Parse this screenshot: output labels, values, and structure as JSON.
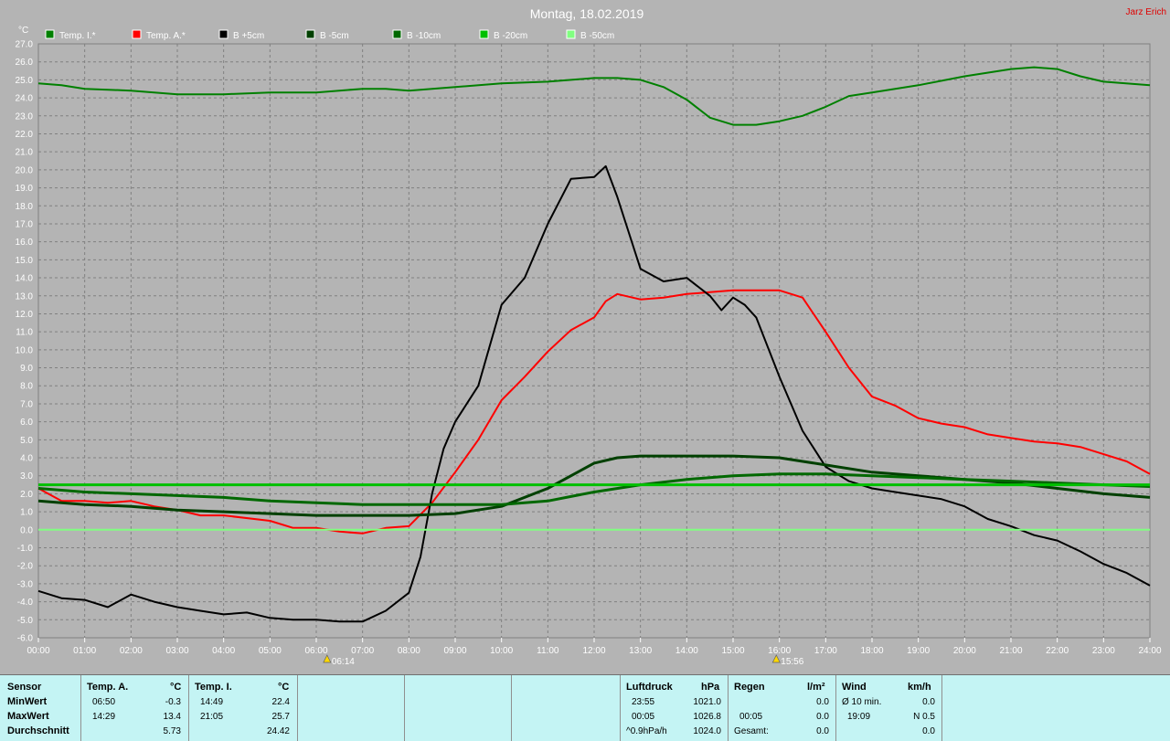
{
  "title": "Montag, 18.02.2019",
  "author": "Jarz Erich",
  "chart_data": {
    "type": "line",
    "ylabel": "°C",
    "ylim": [
      -6,
      27
    ],
    "y_ticks": [
      "27.0",
      "26.0",
      "25.0",
      "24.0",
      "23.0",
      "22.0",
      "21.0",
      "20.0",
      "19.0",
      "18.0",
      "17.0",
      "16.0",
      "15.0",
      "14.0",
      "13.0",
      "12.0",
      "11.0",
      "10.0",
      "9.0",
      "8.0",
      "7.0",
      "6.0",
      "5.0",
      "4.0",
      "3.0",
      "2.0",
      "1.0",
      "0.0",
      "-1.0",
      "-2.0",
      "-3.0",
      "-4.0",
      "-5.0",
      "-6.0"
    ],
    "x_ticks": [
      "00:00",
      "01:00",
      "02:00",
      "03:00",
      "04:00",
      "05:00",
      "06:00",
      "07:00",
      "08:00",
      "09:00",
      "10:00",
      "11:00",
      "12:00",
      "13:00",
      "14:00",
      "15:00",
      "16:00",
      "17:00",
      "18:00",
      "19:00",
      "20:00",
      "21:00",
      "22:00",
      "23:00",
      "24:00"
    ],
    "xlim": [
      0,
      24
    ],
    "grid": true,
    "legend_position": "top",
    "annotations": {
      "sunrise": "06:14",
      "sunset": "15:56"
    },
    "series": [
      {
        "name": "Temp. I.*",
        "color": "#008000",
        "width": 2,
        "x": [
          0,
          0.5,
          1,
          2,
          3,
          4,
          5,
          6,
          7,
          7.5,
          8,
          9,
          10,
          11,
          12,
          12.5,
          13,
          13.5,
          14,
          14.5,
          15,
          15.5,
          16,
          16.5,
          17,
          17.5,
          18,
          19,
          20,
          21,
          21.5,
          22,
          22.5,
          23,
          24
        ],
        "y": [
          24.8,
          24.7,
          24.5,
          24.4,
          24.2,
          24.2,
          24.3,
          24.3,
          24.5,
          24.5,
          24.4,
          24.6,
          24.8,
          24.9,
          25.1,
          25.1,
          25.0,
          24.6,
          23.9,
          22.9,
          22.5,
          22.5,
          22.7,
          23.0,
          23.5,
          24.1,
          24.3,
          24.7,
          25.2,
          25.6,
          25.7,
          25.6,
          25.2,
          24.9,
          24.7
        ]
      },
      {
        "name": "Temp. A.*",
        "color": "#ff0000",
        "width": 2,
        "x": [
          0,
          0.5,
          1,
          1.5,
          2,
          2.5,
          3,
          3.5,
          4,
          5,
          5.5,
          6,
          6.5,
          7,
          7.5,
          8,
          8.5,
          9,
          9.5,
          10,
          10.5,
          11,
          11.5,
          12,
          12.25,
          12.5,
          13,
          13.5,
          14,
          14.5,
          15,
          15.5,
          16,
          16.5,
          17,
          17.5,
          18,
          18.5,
          19,
          19.5,
          20,
          20.5,
          21,
          21.5,
          22,
          22.5,
          23,
          23.5,
          24
        ],
        "y": [
          2.3,
          1.6,
          1.6,
          1.5,
          1.6,
          1.3,
          1.1,
          0.8,
          0.8,
          0.5,
          0.1,
          0.1,
          -0.1,
          -0.2,
          0.1,
          0.2,
          1.5,
          3.2,
          5.0,
          7.2,
          8.5,
          9.9,
          11.1,
          11.8,
          12.7,
          13.1,
          12.8,
          12.9,
          13.1,
          13.2,
          13.3,
          13.3,
          13.3,
          12.9,
          11.0,
          9.0,
          7.4,
          6.9,
          6.2,
          5.9,
          5.7,
          5.3,
          5.1,
          4.9,
          4.8,
          4.6,
          4.2,
          3.8,
          3.1
        ]
      },
      {
        "name": "B +5cm",
        "color": "#000000",
        "width": 2,
        "x": [
          0,
          0.5,
          1,
          1.5,
          2,
          2.5,
          3,
          3.5,
          4,
          4.5,
          5,
          5.5,
          6,
          6.5,
          7,
          7.5,
          8,
          8.25,
          8.5,
          8.75,
          9,
          9.5,
          10,
          10.5,
          11,
          11.5,
          12,
          12.25,
          12.5,
          13,
          13.5,
          14,
          14.5,
          14.75,
          15,
          15.25,
          15.5,
          16,
          16.5,
          17,
          17.5,
          18,
          18.5,
          19,
          19.5,
          20,
          20.5,
          21,
          21.5,
          22,
          22.5,
          23,
          23.5,
          24
        ],
        "y": [
          -3.4,
          -3.8,
          -3.9,
          -4.3,
          -3.6,
          -4.0,
          -4.3,
          -4.5,
          -4.7,
          -4.6,
          -4.9,
          -5.0,
          -5.0,
          -5.1,
          -5.1,
          -4.5,
          -3.5,
          -1.5,
          2.0,
          4.5,
          6.0,
          8.0,
          12.5,
          14.0,
          17.0,
          19.5,
          19.6,
          20.2,
          18.5,
          14.5,
          13.8,
          14.0,
          13.0,
          12.2,
          12.9,
          12.5,
          11.8,
          8.5,
          5.5,
          3.5,
          2.7,
          2.3,
          2.1,
          1.9,
          1.7,
          1.3,
          0.6,
          0.2,
          -0.3,
          -0.6,
          -1.2,
          -1.9,
          -2.4,
          -3.1
        ]
      },
      {
        "name": "B -5cm",
        "color": "#004000",
        "width": 3,
        "x": [
          0,
          1,
          2,
          3,
          4,
          5,
          6,
          7,
          8,
          9,
          10,
          11,
          12,
          12.5,
          13,
          14,
          15,
          16,
          17,
          18,
          19,
          20,
          21,
          22,
          23,
          24
        ],
        "y": [
          1.6,
          1.4,
          1.3,
          1.1,
          1.0,
          0.9,
          0.8,
          0.8,
          0.8,
          0.9,
          1.3,
          2.3,
          3.7,
          4.0,
          4.1,
          4.1,
          4.1,
          4.0,
          3.6,
          3.2,
          3.0,
          2.8,
          2.6,
          2.3,
          2.0,
          1.8
        ]
      },
      {
        "name": "B -10cm",
        "color": "#006800",
        "width": 3,
        "x": [
          0,
          1,
          2,
          3,
          4,
          5,
          6,
          7,
          8,
          9,
          10,
          11,
          12,
          13,
          14,
          15,
          16,
          17,
          18,
          19,
          20,
          21,
          22,
          23,
          24
        ],
        "y": [
          2.3,
          2.1,
          2.0,
          1.9,
          1.8,
          1.6,
          1.5,
          1.4,
          1.4,
          1.4,
          1.4,
          1.6,
          2.1,
          2.5,
          2.8,
          3.0,
          3.1,
          3.1,
          3.0,
          2.9,
          2.8,
          2.7,
          2.6,
          2.5,
          2.4
        ]
      },
      {
        "name": "B -20cm",
        "color": "#00c000",
        "width": 3,
        "x": [
          0,
          1,
          2,
          3,
          4,
          5,
          6,
          7,
          8,
          9,
          10,
          11,
          12,
          13,
          14,
          15,
          16,
          17,
          18,
          19,
          20,
          21,
          22,
          23,
          24
        ],
        "y": [
          2.5,
          2.5,
          2.5,
          2.5,
          2.5,
          2.5,
          2.5,
          2.5,
          2.5,
          2.5,
          2.5,
          2.5,
          2.5,
          2.5,
          2.5,
          2.5,
          2.5,
          2.5,
          2.5,
          2.5,
          2.5,
          2.5,
          2.5,
          2.5,
          2.5
        ]
      },
      {
        "name": "B -50cm",
        "color": "#80ff80",
        "width": 2,
        "x": [
          0,
          24
        ],
        "y": [
          0.0,
          0.0
        ]
      }
    ]
  },
  "stats": {
    "col_sensor": {
      "header": "Sensor",
      "min": "MinWert",
      "max": "MaxWert",
      "avg": "Durchschnitt"
    },
    "temp_a": {
      "header": "Temp. A.",
      "unit": "°C",
      "min_time": "06:50",
      "min_val": "-0.3",
      "max_time": "14:29",
      "max_val": "13.4",
      "avg": "5.73"
    },
    "temp_i": {
      "header": "Temp. I.",
      "unit": "°C",
      "min_time": "14:49",
      "min_val": "22.4",
      "max_time": "21:05",
      "max_val": "25.7",
      "avg": "24.42"
    },
    "pressure": {
      "header": "Luftdruck",
      "unit": "hPa",
      "min_time": "23:55",
      "min_val": "1021.0",
      "max_time": "00:05",
      "max_val": "1026.8",
      "trend_label": "^0.9hPa/h",
      "trend_val": "1024.0"
    },
    "rain": {
      "header": "Regen",
      "unit": "l/m²",
      "min_val": "0.0",
      "max_time": "00:05",
      "max_val": "0.0",
      "total_label": "Gesamt:",
      "total_val": "0.0"
    },
    "wind": {
      "header": "Wind",
      "unit": "km/h",
      "avg_label": "Ø 10 min.",
      "avg_val": "0.0",
      "max_time": "19:09",
      "max_val": "N 0.5",
      "day_val": "0.0"
    }
  }
}
